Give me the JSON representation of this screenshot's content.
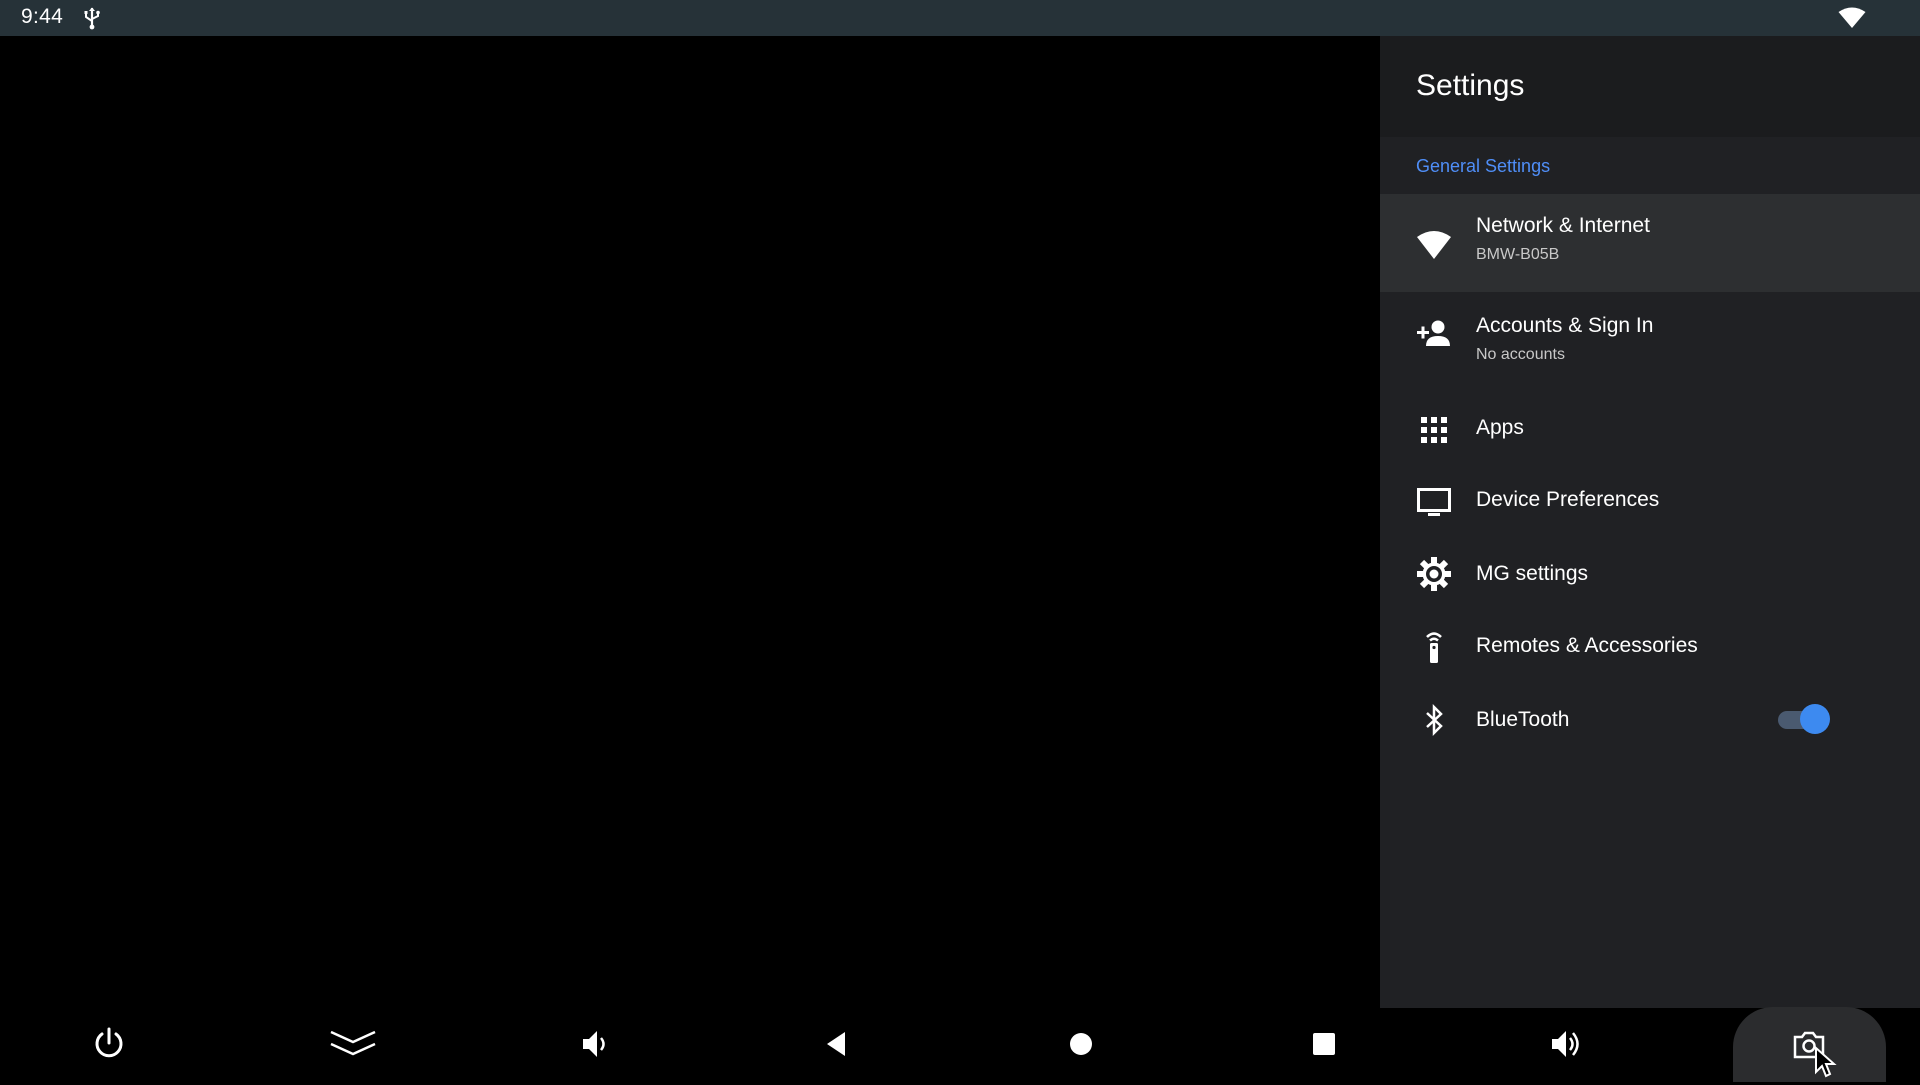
{
  "status_bar": {
    "time": "9:44",
    "icons": [
      "usb-icon",
      "wifi-icon"
    ]
  },
  "settings": {
    "title": "Settings",
    "section": "General Settings",
    "items": [
      {
        "title": "Network & Internet",
        "subtitle": "BMW-B05B",
        "icon": "wifi-icon",
        "selected": true
      },
      {
        "title": "Accounts & Sign In",
        "subtitle": "No accounts",
        "icon": "add-person-icon"
      },
      {
        "title": "Apps",
        "icon": "apps-grid-icon"
      },
      {
        "title": "Device Preferences",
        "icon": "tv-icon"
      },
      {
        "title": "MG settings",
        "icon": "gear-icon"
      },
      {
        "title": "Remotes & Accessories",
        "icon": "remote-icon"
      },
      {
        "title": "BlueTooth",
        "icon": "bluetooth-icon",
        "toggle": true
      }
    ]
  },
  "nav_bar": {
    "buttons": [
      "power-icon",
      "collapse-icon",
      "volume-down-icon",
      "back-icon",
      "home-icon",
      "recents-icon",
      "volume-up-icon",
      "camera-icon"
    ]
  },
  "colors": {
    "status_bar_bg": "#263238",
    "panel_bg": "#202124",
    "section_accent": "#4f8ef7",
    "toggle_on": "#3d8af0"
  }
}
